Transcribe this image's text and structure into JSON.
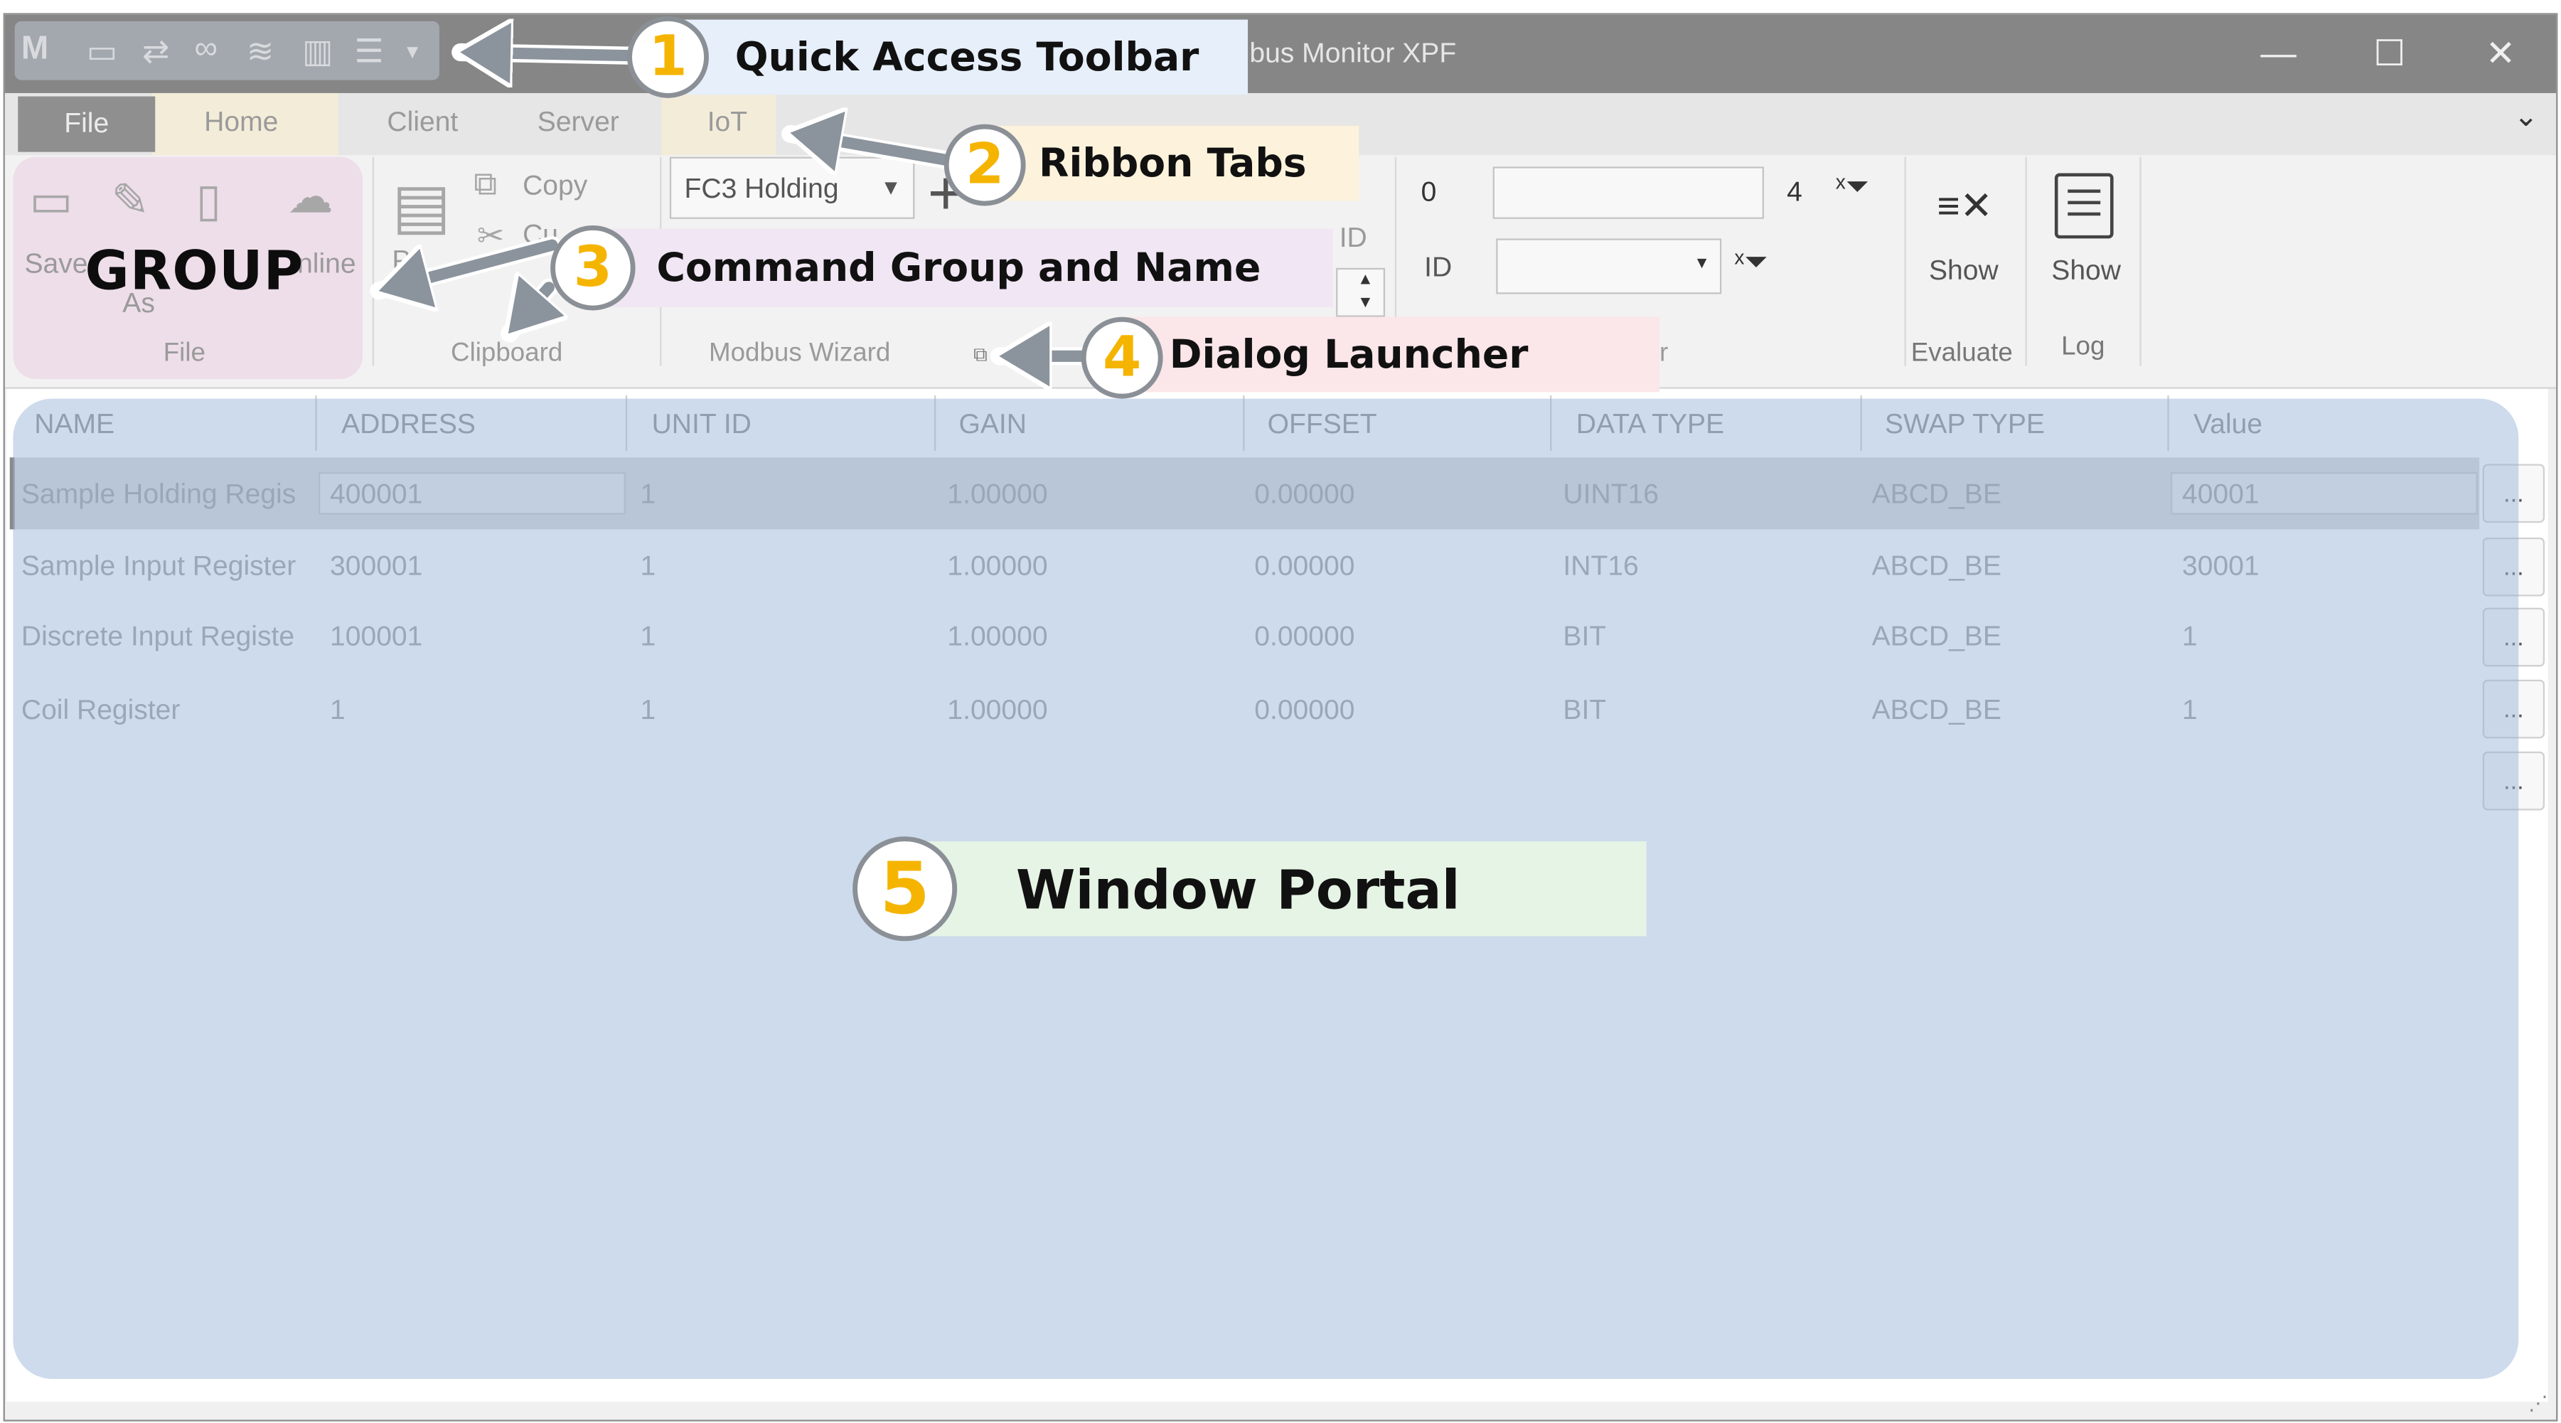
{
  "window": {
    "title": "bus Monitor XPF",
    "controls": {
      "minimize": "—",
      "maximize": "☐",
      "close": "✕"
    }
  },
  "quick_access_toolbar": {
    "logo": "M",
    "icons": [
      "save-icon",
      "refresh-icon",
      "link-icon",
      "database-icon",
      "calculator-icon",
      "checklist-icon",
      "dropdown-arrow-icon"
    ]
  },
  "ribbon": {
    "tabs": [
      "File",
      "Home",
      "Client",
      "Server",
      "IoT"
    ],
    "collapse": "⌄",
    "file_group": {
      "save": "Save",
      "save_as_part": "As",
      "online_part": "nline",
      "label": "File"
    },
    "clipboard_group": {
      "copy": "Copy",
      "cut_part": "Cu",
      "paste_part": "P",
      "label": "Clipboard"
    },
    "wizard_group": {
      "function_select": "FC3 Holding",
      "plus": "+",
      "id_part": "ID",
      "label": "Modbus Wizard",
      "launcher": "⧉"
    },
    "filter_group": {
      "value_zero": "0",
      "value_four": "4",
      "id_label": "ID",
      "label_part": "r"
    },
    "evaluate_group": {
      "button": "Show",
      "label": "Evaluate"
    },
    "log_group": {
      "button": "Show",
      "label": "Log"
    }
  },
  "table": {
    "columns": [
      "NAME",
      "ADDRESS",
      "UNIT ID",
      "GAIN",
      "OFFSET",
      "DATA TYPE",
      "SWAP TYPE",
      "Value"
    ],
    "rows": [
      [
        "Sample Holding Regis",
        "400001",
        "1",
        "1.00000",
        "0.00000",
        "UINT16",
        "ABCD_BE",
        "40001"
      ],
      [
        "Sample Input Register",
        "300001",
        "1",
        "1.00000",
        "0.00000",
        "INT16",
        "ABCD_BE",
        "30001"
      ],
      [
        "Discrete Input Registe",
        "100001",
        "1",
        "1.00000",
        "0.00000",
        "BIT",
        "ABCD_BE",
        "1"
      ],
      [
        "Coil Register",
        "1",
        "1",
        "1.00000",
        "0.00000",
        "BIT",
        "ABCD_BE",
        "1"
      ]
    ],
    "row_button": "..."
  },
  "annotations": {
    "group_word": "GROUP",
    "callouts": [
      {
        "num": "1",
        "text": "Quick Access Toolbar"
      },
      {
        "num": "2",
        "text": "Ribbon Tabs"
      },
      {
        "num": "3",
        "text": "Command Group and Name"
      },
      {
        "num": "4",
        "text": "Dialog Launcher"
      },
      {
        "num": "5",
        "text": "Window Portal"
      }
    ]
  },
  "colors": {
    "portal_overlay": "#96b4d7",
    "badge_number": "#f5b400",
    "callout1_bg": "#e6effa",
    "callout2_bg": "#fdf3dc",
    "callout3_bg": "#f1e6f3",
    "callout4_bg": "#fbe6e9",
    "callout5_bg": "#e6f4e6",
    "group_overlay": "#ecd7e5"
  }
}
